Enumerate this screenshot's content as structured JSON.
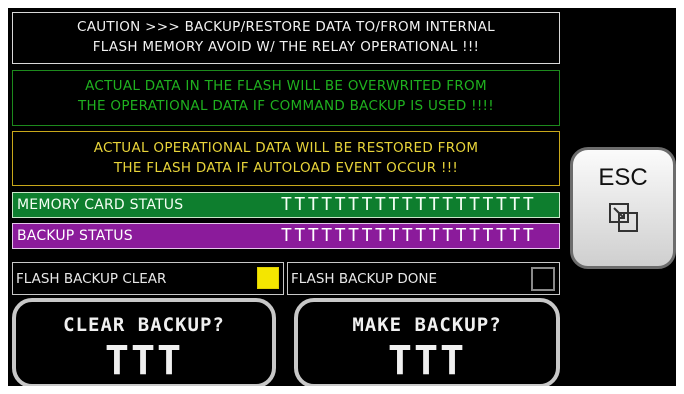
{
  "caution": {
    "line1": "CAUTION >>> BACKUP/RESTORE DATA TO/FROM INTERNAL",
    "line2": "FLASH MEMORY  AVOID W/ THE RELAY OPERATIONAL !!!"
  },
  "warning_backup": {
    "line1": "ACTUAL DATA IN THE FLASH WILL BE OVERWRITED FROM",
    "line2": "THE OPERATIONAL DATA IF COMMAND BACKUP IS USED !!!!"
  },
  "warning_restore": {
    "line1": "ACTUAL OPERATIONAL DATA WILL BE RESTORED FROM",
    "line2": "THE FLASH DATA IF AUTOLOAD EVENT OCCUR !!!"
  },
  "memory_card": {
    "label": "MEMORY CARD STATUS",
    "value": "TTTTTTTTTTTTTTTTTTT"
  },
  "backup_status": {
    "label": "BACKUP STATUS",
    "value": "TTTTTTTTTTTTTTTTTTT"
  },
  "flash_clear": {
    "label": "FLASH BACKUP CLEAR",
    "indicator_color": "#f4e600"
  },
  "flash_done": {
    "label": "FLASH BACKUP DONE",
    "indicator_color": "#000000"
  },
  "clear_button": {
    "title": "CLEAR BACKUP?",
    "value": "TTT"
  },
  "make_button": {
    "title": "MAKE BACKUP?",
    "value": "TTT"
  },
  "esc_button": {
    "label": "ESC",
    "icon": "window-switch-icon"
  },
  "colors": {
    "green_text": "#1fb11f",
    "yellow_text": "#e8d43a",
    "memory_bar": "#0e7e2e",
    "backup_bar": "#8b1b9b"
  }
}
